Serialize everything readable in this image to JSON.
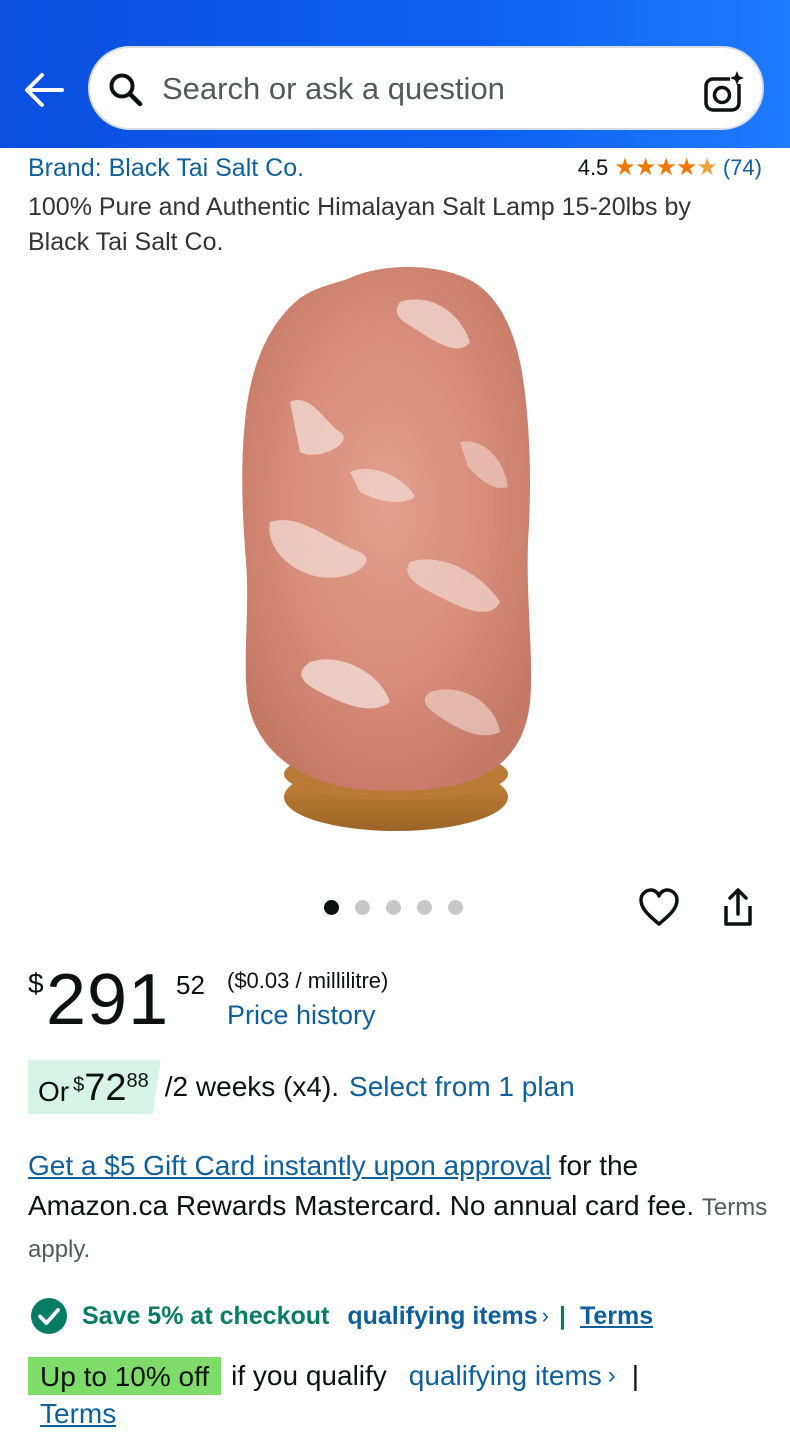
{
  "header": {
    "search_placeholder": "Search or ask a question",
    "back_icon": "arrow-left-icon",
    "camera_icon": "camera-sparkle-icon"
  },
  "product": {
    "brand": "Brand: Black Tai Salt Co.",
    "rating": "4.5",
    "rating_value": 4.5,
    "review_count": "(74)",
    "title": "100% Pure and Authentic Himalayan Salt Lamp 15-20lbs by Black Tai Salt Co.",
    "image_dots_total": 5,
    "image_dots_active": 1
  },
  "price": {
    "symbol": "$",
    "whole": "291",
    "fraction": "52",
    "unit_price": "($0.03 / millilitre)",
    "history_link": "Price history"
  },
  "installment": {
    "prefix": "Or",
    "symbol": "$",
    "whole": "72",
    "fraction": "88",
    "period": "/2 weeks (x4).",
    "link": "Select from 1 plan"
  },
  "promo": {
    "link": "Get a $5 Gift Card instantly upon approval",
    "text": " for the Amazon.ca Rewards Mastercard. No annual card fee. ",
    "terms": "Terms apply."
  },
  "savings": {
    "text": "Save 5% at checkout",
    "link": "qualifying items",
    "chevron": "›",
    "separator": "|",
    "terms": "Terms"
  },
  "offer": {
    "badge": "Up to 10% off",
    "text": "if you qualify",
    "link": "qualifying items",
    "chevron": "›",
    "separator": "|",
    "terms": "Terms"
  },
  "colors": {
    "header_blue": "#0e5ff0",
    "link_blue": "#0f5f9b",
    "star_orange": "#f07800",
    "save_green": "#067d62",
    "offer_green": "#7fdc6b"
  }
}
